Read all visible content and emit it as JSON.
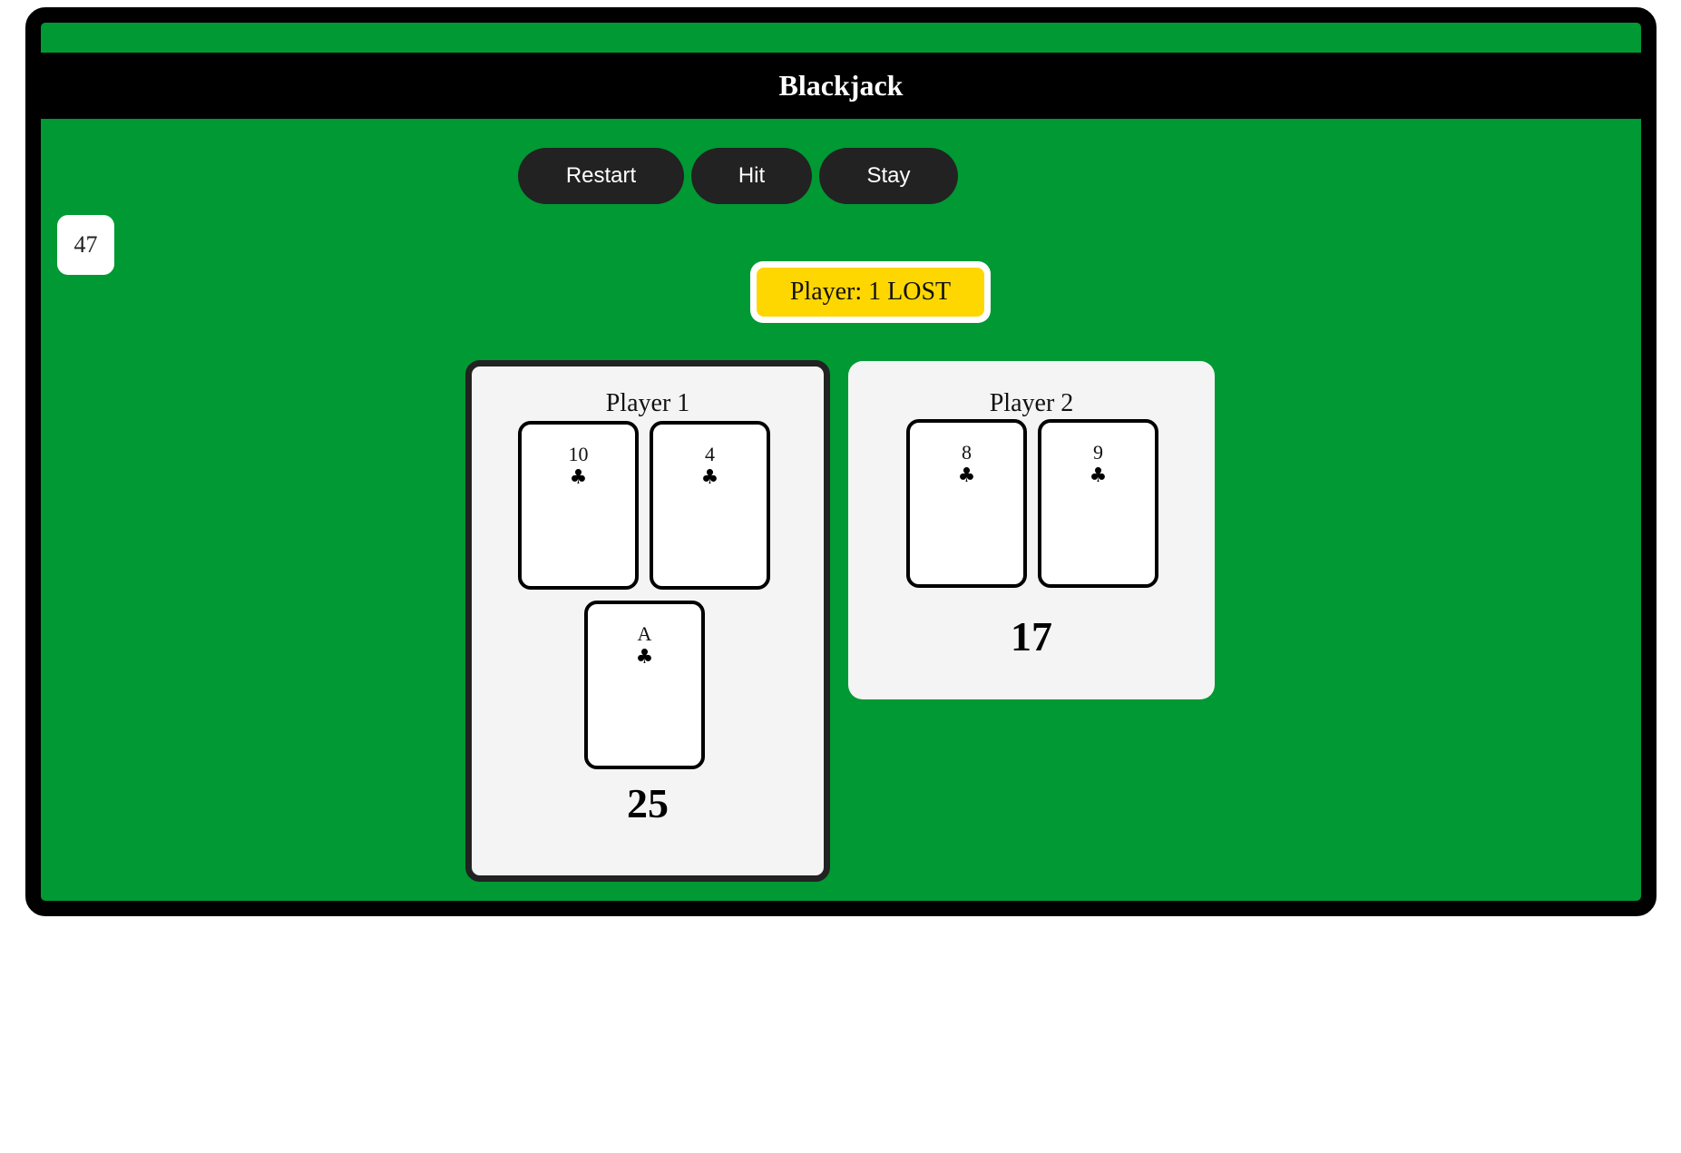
{
  "title": "Blackjack",
  "controls": {
    "restart_label": "Restart",
    "hit_label": "Hit",
    "stay_label": "Stay"
  },
  "deck_count": "47",
  "status": "Player: 1 LOST",
  "players": [
    {
      "name": "Player 1",
      "active": true,
      "total": "25",
      "cards": [
        {
          "rank": "10",
          "suit": "♣",
          "suit_name": "clubs"
        },
        {
          "rank": "4",
          "suit": "♣",
          "suit_name": "clubs"
        },
        {
          "rank": "A",
          "suit": "♣",
          "suit_name": "clubs"
        }
      ]
    },
    {
      "name": "Player 2",
      "active": false,
      "total": "17",
      "cards": [
        {
          "rank": "8",
          "suit": "♣",
          "suit_name": "clubs"
        },
        {
          "rank": "9",
          "suit": "♣",
          "suit_name": "clubs"
        }
      ]
    }
  ],
  "colors": {
    "table": "#009933",
    "frame": "#000000",
    "button": "#222222",
    "status": "#ffd700",
    "panel": "#f4f4f4"
  }
}
